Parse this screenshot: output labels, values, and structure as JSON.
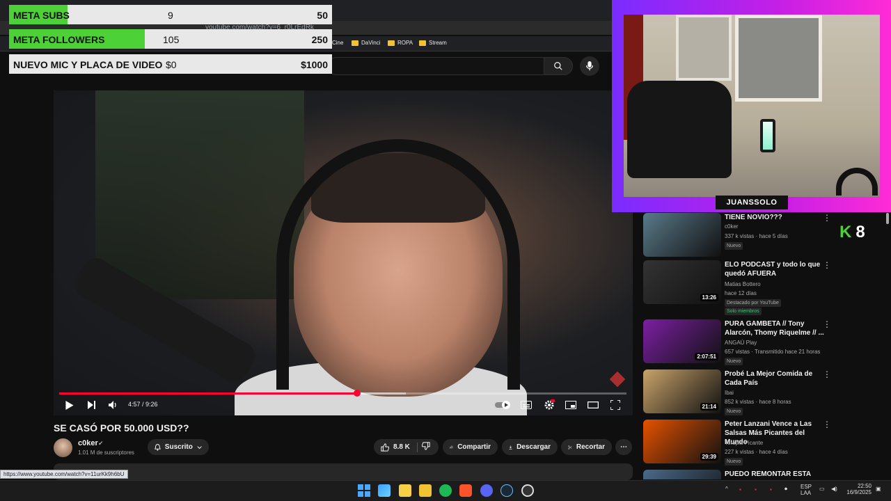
{
  "browser": {
    "url_fragment": "youtube.com/watch?v=6_r0LrEdRk",
    "bookmarks": [
      "Cine",
      "DaVinci",
      "ROPA",
      "Stream"
    ],
    "status_url": "https://www.youtube.com/watch?v=11urKk9h6bU"
  },
  "goals": [
    {
      "name": "META SUBS",
      "current": "9",
      "target": "50",
      "progress": 0.18
    },
    {
      "name": "META FOLLOWERS",
      "current": "105",
      "target": "250",
      "progress": 0.42
    },
    {
      "name": "NUEVO MIC Y PLACA DE VIDEO",
      "current": "$0",
      "target": "$1000",
      "progress": 0
    }
  ],
  "player": {
    "time": "4:57 / 9:26",
    "played_fraction": 0.525,
    "buffered_fraction": 0.611
  },
  "video": {
    "title": "SE CASÓ POR 50.000 USD??",
    "channel": "c0ker",
    "verified_mark": "✔",
    "subscribers": "1.01 M de suscriptores",
    "subscribed_label": "Suscrito",
    "likes": "8.8 K",
    "share_label": "Compartir",
    "download_label": "Descargar",
    "clip_label": "Recortar",
    "more_label": "⋯"
  },
  "webcam": {
    "streamer_name": "JUANSSOLO"
  },
  "side_widget": {
    "letter": "K",
    "number": "8",
    "color": "#4cd137"
  },
  "recommendations": [
    {
      "title": "TIENE NOVIO???",
      "channel": "c0ker",
      "meta": "337 k vistas · hace 5 días",
      "badges": [
        "Nuevo"
      ],
      "duration": "",
      "thumb": "#5a7a8a"
    },
    {
      "title": "ELO PODCAST y todo lo que quedó AFUERA",
      "channel": "Matias Bottero",
      "meta": "hace 12 días",
      "badges": [
        "Destacado por YouTube",
        "Solo miembros"
      ],
      "duration": "13:26",
      "thumb": "#333333"
    },
    {
      "title": "PURA GAMBETA // Tony Alarcón, Thomy Riquelme // ...",
      "channel": "ANGAÚ Play",
      "meta": "657 vistas · Transmitido hace 21 horas",
      "badges": [
        "Nuevo"
      ],
      "duration": "2:07:51",
      "thumb": "#7b1fa2"
    },
    {
      "title": "Probé La Mejor Comida de Cada País",
      "channel": "Ibai",
      "meta": "852 k vistas · hace 8 horas",
      "badges": [
        "Nuevo"
      ],
      "duration": "21:14",
      "thumb": "#c9a36a"
    },
    {
      "title": "Peter Lanzani Vence a Las Salsas Más Picantes del Mundo",
      "channel": "Terapia Picante",
      "meta": "227 k vistas · hace 4 días",
      "badges": [
        "Nuevo"
      ],
      "duration": "29:39",
      "thumb": "#e65100"
    },
    {
      "title": "PUEDO REMONTAR ESTA",
      "channel": "",
      "meta": "",
      "badges": [],
      "duration": "",
      "thumb": "#4a6a8a"
    }
  ],
  "taskbar": {
    "lang_top": "ESP",
    "lang_bottom": "LAA",
    "time": "22:50",
    "date": "16/9/2025"
  },
  "colors": {
    "accent_red": "#ff0033",
    "goal_fill": "#4cd137",
    "webcam_gradient_start": "#7a2cff",
    "webcam_gradient_end": "#ff2bd6"
  }
}
